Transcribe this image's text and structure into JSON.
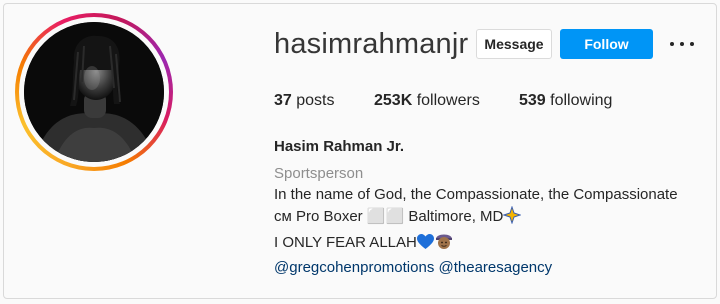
{
  "profile": {
    "username": "hasimrahmanjr",
    "full_name": "Hasim Rahman Jr.",
    "category": "Sportsperson"
  },
  "actions": {
    "message_label": "Message",
    "follow_label": "Follow",
    "more_icon": "ellipsis-horizontal-icon"
  },
  "stats": {
    "posts_count": "37",
    "posts_label": "posts",
    "followers_count": "253K",
    "followers_label": "followers",
    "following_count": "539",
    "following_label": "following"
  },
  "bio": {
    "line1": "In the name of God, the Compassionate, the Compassionate",
    "line2": "см Pro Boxer ⬜⬜ Baltimore, MD",
    "line2_icon": "sparkle-star-icon",
    "line3": "I ONLY FEAR ALLAH",
    "line3_icons": [
      "blue-heart-icon",
      "man-with-headwear-icon"
    ],
    "link1": "@gregcohenpromotions",
    "link2": "@thearesagency"
  },
  "colors": {
    "follow_button": "#0095f6",
    "link": "#00376b",
    "muted": "#8e8e8e",
    "text": "#262626"
  }
}
